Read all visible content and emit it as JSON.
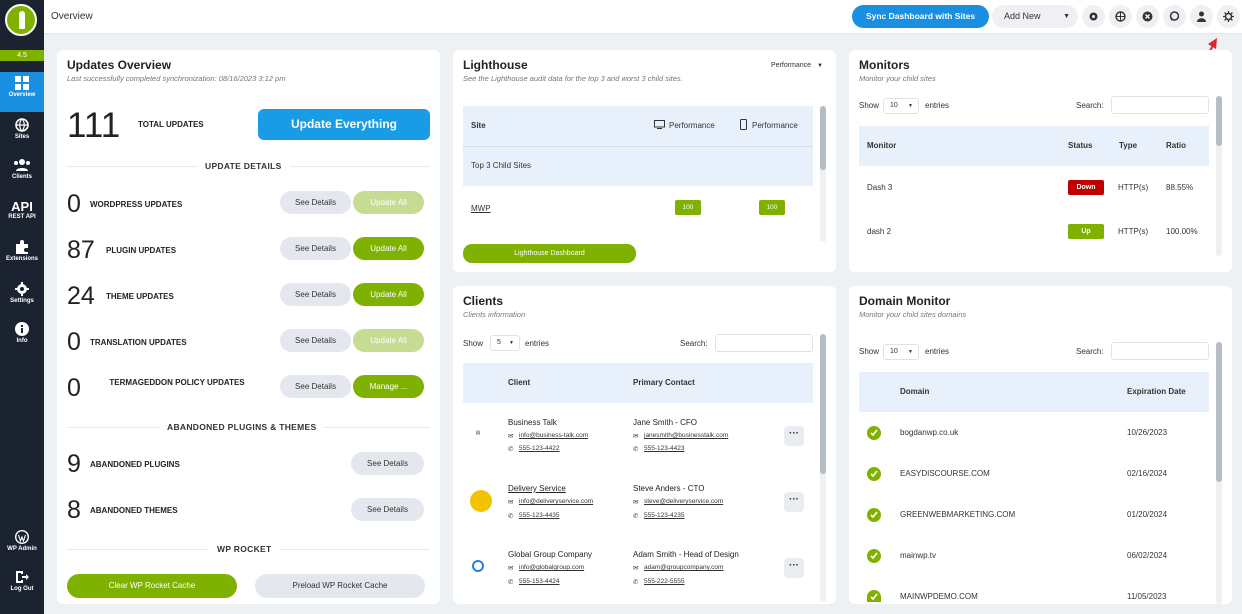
{
  "sidebar": {
    "version": "4.5",
    "items": [
      {
        "label": "Overview"
      },
      {
        "label": "Sites"
      },
      {
        "label": "Clients"
      },
      {
        "label": "REST API",
        "glyph": "API"
      },
      {
        "label": "Extensions"
      },
      {
        "label": "Settings"
      },
      {
        "label": "Info"
      },
      {
        "label": "WP Admin"
      },
      {
        "label": "Log Out"
      }
    ]
  },
  "topbar": {
    "title": "Overview",
    "sync_label": "Sync Dashboard with Sites",
    "add_new_label": "Add New"
  },
  "updates": {
    "title": "Updates Overview",
    "subtitle": "Last successfully completed synchronization: 08/16/2023 3:12 pm",
    "total": "111",
    "total_label": "TOTAL UPDATES",
    "update_everything": "Update Everything",
    "details_heading": "UPDATE DETAILS",
    "rows": [
      {
        "count": "0",
        "label": "WORDPRESS UPDATES",
        "see": "See Details",
        "action": "Update All"
      },
      {
        "count": "87",
        "label": "PLUGIN UPDATES",
        "see": "See Details",
        "action": "Update All"
      },
      {
        "count": "24",
        "label": "THEME UPDATES",
        "see": "See Details",
        "action": "Update All"
      },
      {
        "count": "0",
        "label": "TRANSLATION UPDATES",
        "see": "See Details",
        "action": "Update All"
      },
      {
        "count": "0",
        "label": "TERMAGEDDON POLICY UPDATES",
        "see": "See Details",
        "action": "Manage ..."
      }
    ],
    "abandoned_heading": "ABANDONED PLUGINS & THEMES",
    "abandoned": [
      {
        "count": "9",
        "label": "ABANDONED PLUGINS",
        "see": "See Details"
      },
      {
        "count": "8",
        "label": "ABANDONED THEMES",
        "see": "See Details"
      }
    ],
    "rocket_heading": "WP ROCKET",
    "clear_cache": "Clear WP Rocket Cache",
    "preload_cache": "Preload WP Rocket Cache"
  },
  "lighthouse": {
    "title": "Lighthouse",
    "subtitle": "See the Lighthouse audit data for the top 3 and worst 3 child sites.",
    "dropdown": "Performance",
    "col_site": "Site",
    "col_desktop": "Performance",
    "col_mobile": "Performance",
    "group": "Top 3 Child Sites",
    "row": {
      "site": "MWP",
      "desktop": "100",
      "mobile": "100"
    },
    "button": "Lighthouse Dashboard"
  },
  "monitors": {
    "title": "Monitors",
    "subtitle": "Monitor your child sites",
    "show": "Show",
    "entries_value": "10",
    "entries": "entries",
    "search": "Search:",
    "cols": [
      "Monitor",
      "Status",
      "Type",
      "Ratio"
    ],
    "rows": [
      {
        "name": "Dash 3",
        "status": "Down",
        "type": "HTTP(s)",
        "ratio": "88.55%"
      },
      {
        "name": "dash 2",
        "status": "Up",
        "type": "HTTP(s)",
        "ratio": "100.00%"
      }
    ]
  },
  "clients": {
    "title": "Clients",
    "subtitle": "Clients information",
    "show": "Show",
    "entries_value": "5",
    "entries": "entries",
    "search": "Search:",
    "col_client": "Client",
    "col_contact": "Primary Contact",
    "rows": [
      {
        "name": "Business Talk",
        "email": "info@business-talk.com",
        "phone": "555-123-4422",
        "contact": "Jane Smith - CFO",
        "c_email": "janesmith@businesstalk.com",
        "c_phone": "555-123-4423"
      },
      {
        "name": "Delivery Service",
        "email": "info@deliveryservice.com",
        "phone": "555-123-4435",
        "contact": "Steve Anders - CTO",
        "c_email": "steve@deliveryservice.com",
        "c_phone": "555-123-4235"
      },
      {
        "name": "Global Group Company",
        "email": "info@globalgroup.com",
        "phone": "555-153-4424",
        "contact": "Adam Smith - Head of Design",
        "c_email": "adam@groupcompany.com",
        "c_phone": "555-222-5555"
      }
    ]
  },
  "domain": {
    "title": "Domain Monitor",
    "subtitle": "Monitor your child sites domains",
    "show": "Show",
    "entries_value": "10",
    "entries": "entries",
    "search": "Search:",
    "col_domain": "Domain",
    "col_exp": "Expiration Date",
    "rows": [
      {
        "domain": "bogdanwp.co.uk",
        "exp": "10/26/2023"
      },
      {
        "domain": "EASYDISCOURSE.COM",
        "exp": "02/16/2024"
      },
      {
        "domain": "GREENWEBMARKETING.COM",
        "exp": "01/20/2024"
      },
      {
        "domain": "mainwp.tv",
        "exp": "06/02/2024"
      },
      {
        "domain": "MAINWPDEMO.COM",
        "exp": "11/05/2023"
      }
    ]
  }
}
